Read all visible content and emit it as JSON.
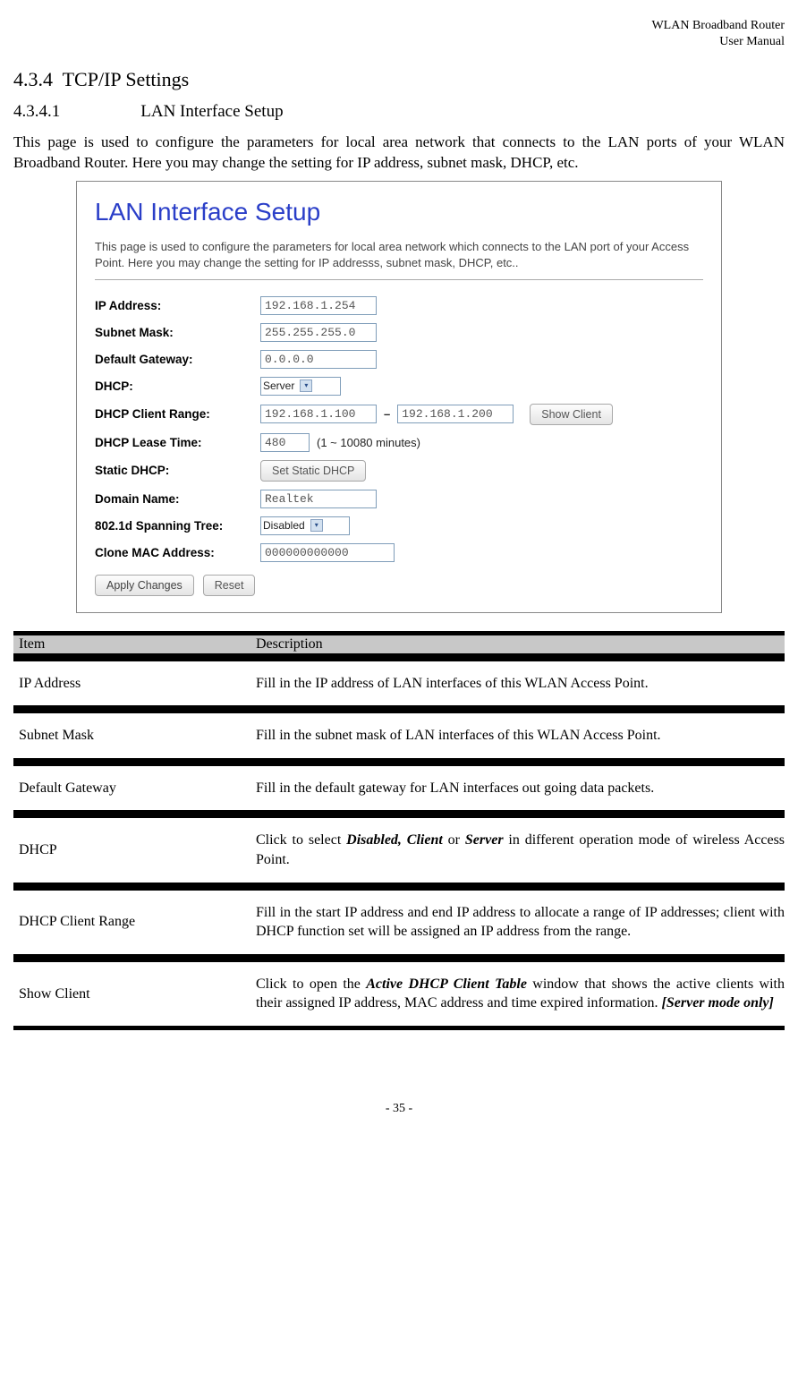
{
  "header": {
    "line1": "WLAN Broadband Router",
    "line2": "User Manual"
  },
  "section": {
    "num1": "4.3.4",
    "title1": "TCP/IP Settings",
    "num2": "4.3.4.1",
    "title2": "LAN Interface Setup",
    "intro": "This page is used to configure the parameters for local area network that connects to the LAN ports of your WLAN Broadband Router. Here you may change the setting for IP address, subnet mask, DHCP, etc."
  },
  "screenshot": {
    "title": "LAN Interface Setup",
    "desc": "This page is used to configure the parameters for local area network which connects to the LAN port of your Access Point. Here you may change the setting for IP addresss, subnet mask, DHCP, etc..",
    "fields": {
      "ip_label": "IP Address:",
      "ip_value": "192.168.1.254",
      "subnet_label": "Subnet Mask:",
      "subnet_value": "255.255.255.0",
      "gateway_label": "Default Gateway:",
      "gateway_value": "0.0.0.0",
      "dhcp_label": "DHCP:",
      "dhcp_value": "Server",
      "range_label": "DHCP Client Range:",
      "range_from": "192.168.1.100",
      "range_to": "192.168.1.200",
      "show_client_btn": "Show Client",
      "lease_label": "DHCP Lease Time:",
      "lease_value": "480",
      "lease_note": "(1 ~ 10080 minutes)",
      "static_label": "Static DHCP:",
      "static_btn": "Set Static DHCP",
      "domain_label": "Domain Name:",
      "domain_value": "Realtek",
      "spanning_label": "802.1d Spanning Tree:",
      "spanning_value": "Disabled",
      "mac_label": "Clone MAC Address:",
      "mac_value": "000000000000",
      "apply_btn": "Apply Changes",
      "reset_btn": "Reset"
    }
  },
  "table": {
    "h1": "Item",
    "h2": "Description",
    "rows": [
      {
        "item": "IP Address",
        "desc": "Fill in the IP address of LAN interfaces of this WLAN Access Point."
      },
      {
        "item": "Subnet Mask",
        "desc": "Fill in the subnet mask of LAN interfaces of this WLAN Access Point."
      },
      {
        "item": "Default Gateway",
        "desc": "Fill in the default gateway for LAN interfaces out going data packets."
      },
      {
        "item": "DHCP",
        "desc_pre": "Click to select ",
        "desc_bi1": "Disabled, Client",
        "desc_mid": " or ",
        "desc_bi2": "Server",
        "desc_post": " in different operation mode of wireless Access Point."
      },
      {
        "item": "DHCP Client Range",
        "desc": "Fill in the start IP address and end IP address to allocate a range of IP addresses; client with DHCP function set will be assigned an IP address from the range."
      },
      {
        "item": "Show Client",
        "desc_pre": "Click to open the ",
        "desc_bi1": "Active DHCP Client Table",
        "desc_mid": " window that shows the active clients with their assigned IP address, MAC address and time expired information. ",
        "desc_bi2": "[Server mode only]",
        "desc_post": ""
      }
    ]
  },
  "footer": "- 35 -"
}
